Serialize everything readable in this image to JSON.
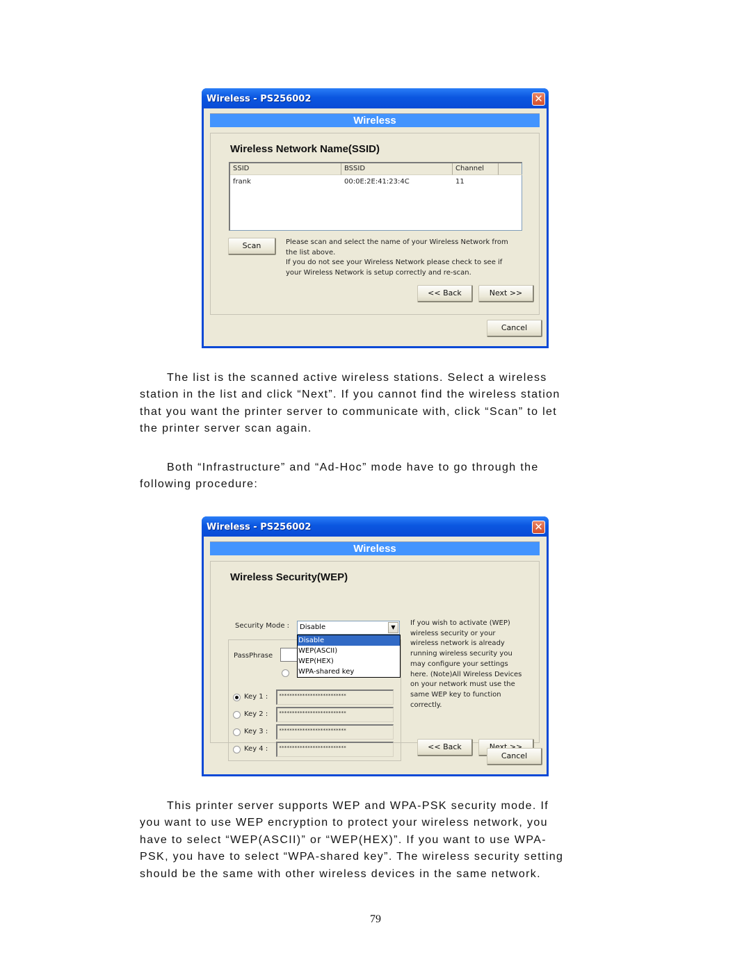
{
  "dialog1": {
    "title": "Wireless - PS256002",
    "close_glyph": "✕",
    "banner": "Wireless",
    "section_title": "Wireless Network Name(SSID)",
    "list": {
      "columns": [
        "SSID",
        "BSSID",
        "Channel"
      ],
      "rows": [
        {
          "ssid": "frank",
          "bssid": "00:0E:2E:41:23:4C",
          "channel": "11"
        }
      ]
    },
    "scan_button": "Scan",
    "help_lines": [
      "Please scan and select the name of your Wireless Network from",
      "the list above.",
      "If you do not see your Wireless Network please check to see if",
      "your Wireless Network is setup correctly and re-scan."
    ],
    "back_button": "<< Back",
    "next_button": "Next >>",
    "cancel_button": "Cancel"
  },
  "dialog2": {
    "title": "Wireless - PS256002",
    "close_glyph": "✕",
    "banner": "Wireless",
    "section_title": "Wireless Security(WEP)",
    "security_mode_label": "Security Mode :",
    "security_mode_value": "Disable",
    "dropdown_arrow": "▼",
    "dropdown_options": [
      "Disable",
      "WEP(ASCII)",
      "WEP(HEX)",
      "WPA-shared key"
    ],
    "dropdown_selected": "Disable",
    "passphrase_label": "PassPhrase",
    "keys": [
      {
        "label": "Key 1 :",
        "value": "**************************",
        "checked": true
      },
      {
        "label": "Key 2 :",
        "value": "**************************",
        "checked": false
      },
      {
        "label": "Key 3 :",
        "value": "**************************",
        "checked": false
      },
      {
        "label": "Key 4 :",
        "value": "**************************",
        "checked": false
      }
    ],
    "help_lines": [
      "If you wish to activate (WEP)",
      "wireless security or your",
      "wireless network is already",
      "running wireless security you",
      "may configure your settings",
      "here. (Note)All Wireless Devices",
      "on your network must use the",
      "same WEP key to function",
      "correctly."
    ],
    "back_button": "<< Back",
    "next_button": "Next >>",
    "cancel_button": "Cancel"
  },
  "document": {
    "para1": [
      "The list is the scanned active wireless stations. Select a wireless",
      "station in the list and click “Next”. If you cannot find the wireless station",
      "that you want the printer server to communicate with, click “Scan” to let",
      "the printer server scan again."
    ],
    "para2": [
      "Both “Infrastructure” and “Ad-Hoc” mode have to go through the",
      "following procedure:"
    ],
    "para3": [
      "This printer server supports WEP and WPA-PSK security mode. If",
      "you want to use WEP encryption to protect your wireless network, you",
      "have to select “WEP(ASCII)” or “WEP(HEX)”. If you want to use WPA-",
      "PSK, you have to select “WPA-shared key”. The wireless security setting",
      "should be the same with other wireless devices in the same network."
    ],
    "page_number": "79"
  },
  "colors": {
    "titlebar": "#0a4bd6",
    "banner": "#4394fe",
    "dialog_bg": "#ece9d8",
    "selection": "#316ac5",
    "close_button": "#d34e2c"
  }
}
